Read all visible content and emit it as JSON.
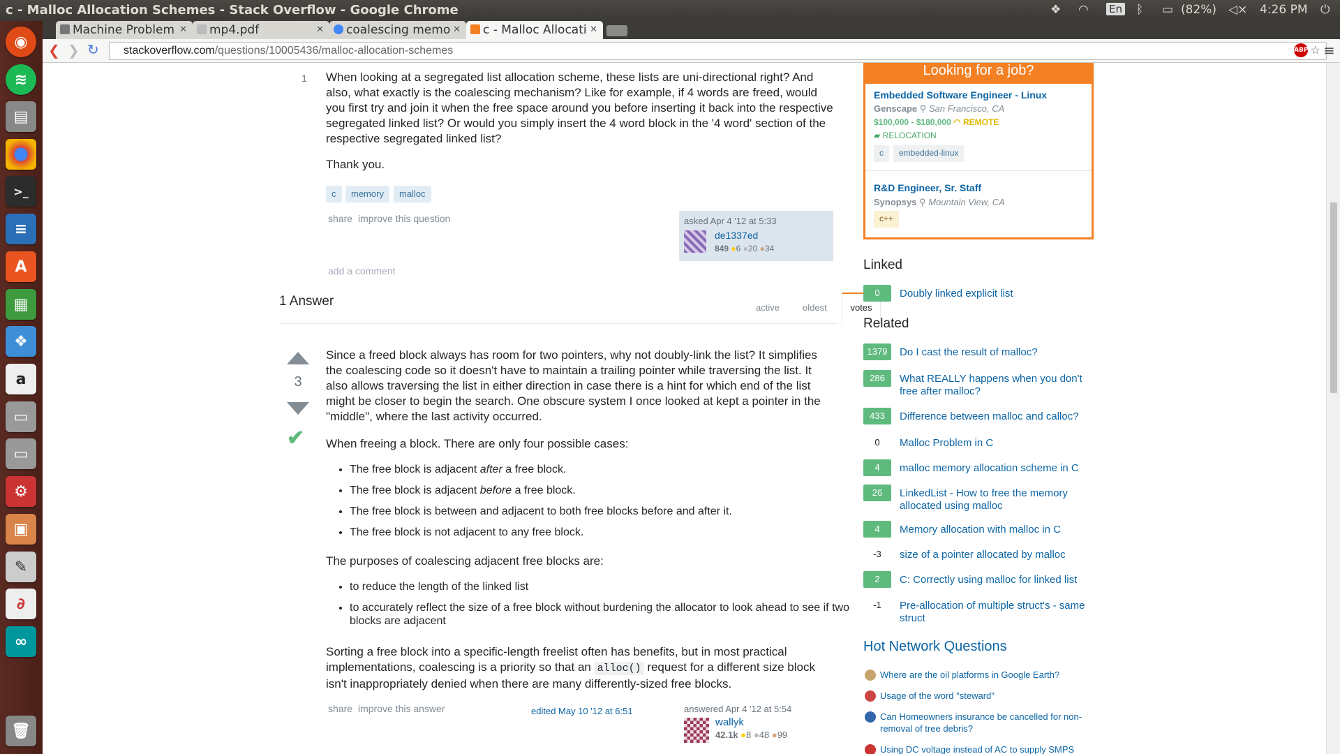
{
  "window": {
    "title": "c - Malloc Allocation Schemes - Stack Overflow - Google Chrome",
    "lang": "En",
    "battery": "(82%)",
    "time": "4:26 PM"
  },
  "tabs": [
    {
      "label": "Machine Problem"
    },
    {
      "label": "mp4.pdf"
    },
    {
      "label": "coalescing memo"
    },
    {
      "label": "c - Malloc Allocati"
    }
  ],
  "address": {
    "host": "stackoverflow.com",
    "path": "/questions/10005436/malloc-allocation-schemes"
  },
  "question": {
    "vote": "1",
    "paragraph": "When looking at a segregated list allocation scheme, these lists are uni-directional right? And also, what exactly is the coalescing mechanism? Like for example, if 4 words are freed, would you first try and join it when the free space around you before inserting it back into the respective segregated linked list? Or would you simply insert the 4 word block in the '4 word' section of the respective segregated linked list?",
    "thanks": "Thank you.",
    "tags": [
      "c",
      "memory",
      "malloc"
    ],
    "share": "share",
    "improve": "improve this question",
    "asked": "asked Apr 4 '12 at 5:33",
    "user": "de1337ed",
    "rep": "849",
    "gold": "6",
    "silver": "20",
    "bronze": "34",
    "add_comment": "add a comment"
  },
  "answers_header": {
    "count": "1 Answer",
    "tabs": [
      "active",
      "oldest",
      "votes"
    ]
  },
  "answer": {
    "vote": "3",
    "p1": "Since a freed block always has room for two pointers, why not doubly-link the list? It simplifies the coalescing code so it doesn't have to maintain a trailing pointer while traversing the list. It also allows traversing the list in either direction in case there is a hint for which end of the list might be closer to begin the search. One obscure system I once looked at kept a pointer in the \"middle\", where the last activity occurred.",
    "p2": "When freeing a block. There are only four possible cases:",
    "b1a": "The free block is adjacent ",
    "b1em": "after",
    "b1b": " a free block.",
    "b2a": "The free block is adjacent ",
    "b2em": "before",
    "b2b": " a free block.",
    "b3": "The free block is between and adjacent to both free blocks before and after it.",
    "b4": "The free block is not adjacent to any free block.",
    "p3": "The purposes of coalescing adjacent free blocks are:",
    "c1": "to reduce the length of the linked list",
    "c2": "to accurately reflect the size of a free block without burdening the allocator to look ahead to see if two blocks are adjacent",
    "p4a": "Sorting a free block into a specific-length freelist often has benefits, but in most practical implementations, coalescing is a priority so that an ",
    "p4code": "alloc()",
    "p4b": " request for a different size block isn't inappropriately denied when there are many differently-sized free blocks.",
    "share": "share",
    "improve": "improve this answer",
    "edited": "edited May 10 '12 at 6:51",
    "answered": "answered Apr 4 '12 at 5:54",
    "user": "wallyk",
    "rep": "42.1k",
    "gold": "8",
    "silver": "48",
    "bronze": "99"
  },
  "jobs": {
    "header": "Looking for a job?",
    "items": [
      {
        "title": "Embedded Software Engineer - Linux",
        "company": "Genscape",
        "location": "San Francisco, CA",
        "salary": "$100,000 - $180,000",
        "remote": "REMOTE",
        "relocation": "RELOCATION",
        "tags": [
          "c",
          "embedded-linux"
        ]
      },
      {
        "title": "R&D Engineer, Sr. Staff",
        "company": "Synopsys",
        "location": "Mountain View, CA",
        "tags": [
          "c++"
        ]
      }
    ]
  },
  "linked": {
    "title": "Linked",
    "items": [
      {
        "count": "0",
        "text": "Doubly linked explicit list"
      }
    ]
  },
  "related": {
    "title": "Related",
    "items": [
      {
        "count": "1379",
        "text": "Do I cast the result of malloc?"
      },
      {
        "count": "286",
        "text": "What REALLY happens when you don't free after malloc?"
      },
      {
        "count": "433",
        "text": "Difference between malloc and calloc?"
      },
      {
        "count": "0",
        "text": "Malloc Problem in C"
      },
      {
        "count": "4",
        "text": "malloc memory allocation scheme in C"
      },
      {
        "count": "26",
        "text": "LinkedList - How to free the memory allocated using malloc"
      },
      {
        "count": "4",
        "text": "Memory allocation with malloc in C"
      },
      {
        "count": "-3",
        "text": "size of a pointer allocated by malloc"
      },
      {
        "count": "2",
        "text": "C: Correctly using malloc for linked list"
      },
      {
        "count": "-1",
        "text": "Pre-allocation of multiple struct's - same struct"
      }
    ]
  },
  "hot": {
    "title": "Hot Network Questions",
    "items": [
      {
        "text": "Where are the oil platforms in Google Earth?"
      },
      {
        "text": "Usage of the word \"steward\""
      },
      {
        "text": "Can Homeowners insurance be cancelled for non-removal of tree debris?"
      },
      {
        "text": "Using DC voltage instead of AC to supply SMPS"
      }
    ]
  },
  "colors": {
    "accent": "#f48024",
    "link": "#0c65a5",
    "upvoted": "#5fba7d",
    "launcher": "#4a2018"
  }
}
